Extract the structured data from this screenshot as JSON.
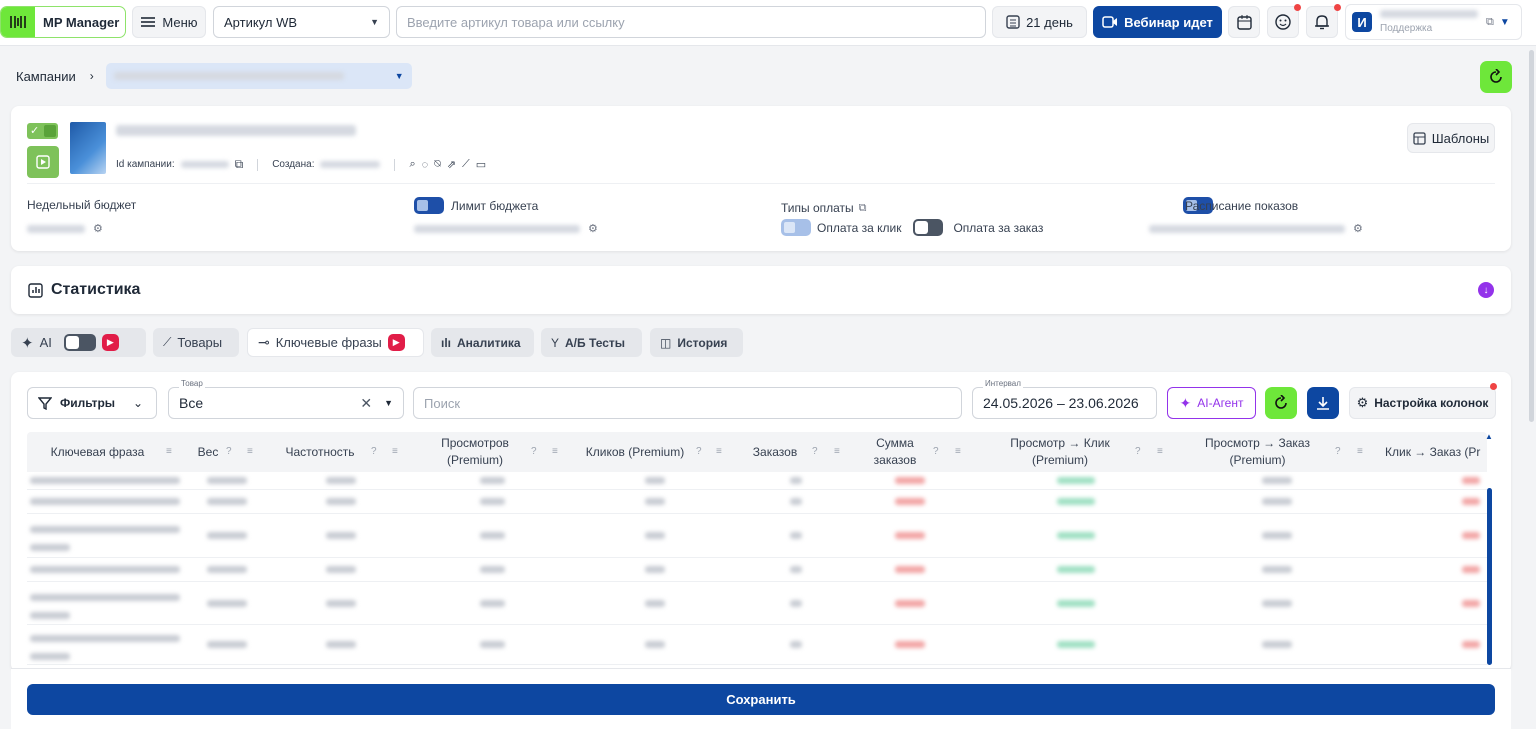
{
  "header": {
    "logo_text": "MP Manager",
    "menu_label": "Меню",
    "article_select": "Артикул WB",
    "search_placeholder": "Введите артикул товара или ссылку",
    "days_label": "21 день",
    "webinar_label": "Вебинар идет",
    "user_initial": "И",
    "user_name": "",
    "user_role": "Поддержка"
  },
  "breadcrumb": {
    "root": "Кампании",
    "current": ""
  },
  "campaign": {
    "name": "",
    "id_label": "Id кампании:",
    "id_value": "",
    "created_label": "Создана:",
    "created_value": "",
    "templates_label": "Шаблоны",
    "weekly_budget_label": "Недельный бюджет",
    "weekly_budget_value": "",
    "budget_limit_label": "Лимит бюджета",
    "budget_limit_value": "",
    "payment_types_label": "Типы оплаты",
    "pay_click_label": "Оплата за клик",
    "pay_order_label": "Оплата за заказ",
    "schedule_label": "Расписание показов",
    "schedule_value": ""
  },
  "statistics": {
    "title": "Статистика"
  },
  "tabs": [
    {
      "label": "AI"
    },
    {
      "label": "Товары"
    },
    {
      "label": "Ключевые фразы"
    },
    {
      "label": "Аналитика"
    },
    {
      "label": "А/Б Тесты"
    },
    {
      "label": "История"
    }
  ],
  "filters": {
    "filters_label": "Фильтры",
    "product_caption": "Товар",
    "product_value": "Все",
    "search_placeholder": "Поиск",
    "interval_caption": "Интервал",
    "interval_value": "24.05.2026 – 23.06.2026",
    "ai_agent_label": "AI-Агент",
    "columns_label": "Настройка колонок"
  },
  "table": {
    "columns": [
      "Ключевая фраза",
      "Вес",
      "Частотность",
      "Просмотров (Premium)",
      "Кликов (Premium)",
      "Заказов",
      "Сумма заказов",
      "Просмотр → Клик (Premium)",
      "Просмотр → Заказ (Premium)",
      "Клик → Заказ (Pr"
    ]
  },
  "save_label": "Сохранить",
  "colors": {
    "primary": "#0d47a1",
    "accent_green": "#6ee73a",
    "alert_red": "#ef4444",
    "purple": "#9333ea"
  }
}
